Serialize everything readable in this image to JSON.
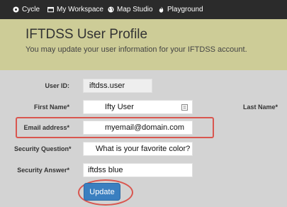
{
  "nav": {
    "items": [
      {
        "label": "Cycle",
        "icon": "cycle-icon"
      },
      {
        "label": "My Workspace",
        "icon": "workspace-icon"
      },
      {
        "label": "Map Studio",
        "icon": "globe-icon"
      },
      {
        "label": "Playground",
        "icon": "flame-icon"
      }
    ]
  },
  "header": {
    "title": "IFTDSS User Profile",
    "subtitle": "You may update your user information for your IFTDSS account."
  },
  "form": {
    "user_id_label": "User ID:",
    "user_id_value": "iftdss.user",
    "first_name_label": "First Name*",
    "first_name_value": "Ifty User",
    "last_name_label": "Last Name*",
    "email_label": "Email address*",
    "email_value": "myemail@domain.com",
    "security_question_label": "Security Question*",
    "security_question_value": "What is your favorite color?",
    "security_answer_label": "Security Answer*",
    "security_answer_value": "iftdss blue"
  },
  "actions": {
    "update_label": "Update"
  },
  "colors": {
    "navbar": "#2b2b2b",
    "header": "#cdcc97",
    "body": "#d3d3d3",
    "highlight": "#d9564f",
    "button": "#3a7fc0"
  }
}
